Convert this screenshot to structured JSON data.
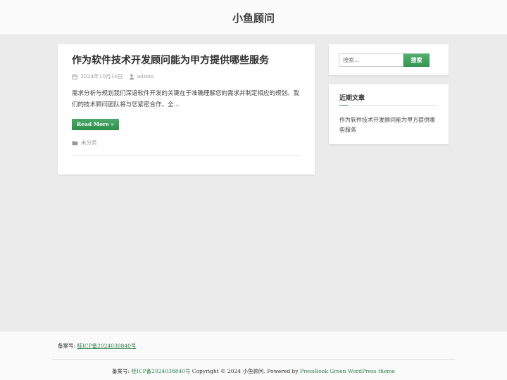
{
  "header": {
    "site_title": "小鱼顾问"
  },
  "post": {
    "title": "作为软件技术开发顾问能为甲方提供哪些服务",
    "date": "2024年10月16日",
    "author": "admin",
    "excerpt": "需求分析与规划我们深谙软件开发的关键在于准确理解您的需求并制定相应的规划。我们的技术顾问团队将与您紧密合作，全...",
    "read_more": "Read More »",
    "category": "未分类",
    "icons": {
      "date": "calendar-icon",
      "author": "user-icon",
      "category": "folder-icon"
    }
  },
  "search": {
    "placeholder": "搜索...",
    "button": "搜索"
  },
  "recent": {
    "title": "近期文章",
    "items": [
      "作为软件技术开发顾问能为甲方提供哪些服务"
    ]
  },
  "footer": {
    "icp_label": "备案号:",
    "icp_link": "桂ICP备2024038840号",
    "credit_prefix": "备案号:",
    "credit_icp": "桂ICP备2024038840号",
    "credit_copyright": "Copyright © 2024 小鱼顾问.",
    "credit_powered": "Powered by",
    "credit_theme": "PressBook Green WordPress theme"
  },
  "colors": {
    "accent": "#3a9d58",
    "link": "#2e7d45",
    "background": "#ebebeb"
  }
}
